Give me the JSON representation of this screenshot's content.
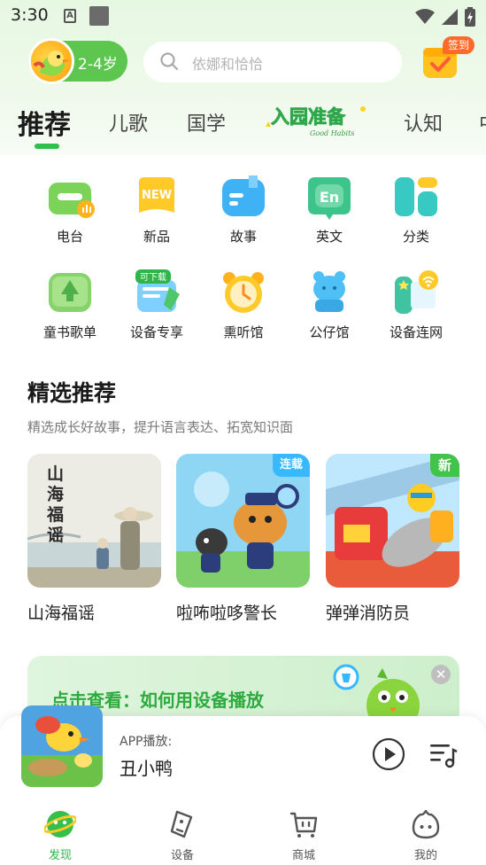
{
  "status_bar": {
    "time": "3:30",
    "a_icon": "A"
  },
  "header": {
    "age_label": "2-4岁",
    "search_placeholder": "依娜和恰恰",
    "checkin_label": "签到"
  },
  "tabs": [
    {
      "label": "推荐",
      "active": true
    },
    {
      "label": "儿歌"
    },
    {
      "label": "国学"
    },
    {
      "label": "入园准备",
      "sub": "Good Habits",
      "banner": true
    },
    {
      "label": "认知"
    },
    {
      "label": "中"
    }
  ],
  "grid": [
    {
      "label": "电台",
      "icon": "radio-icon"
    },
    {
      "label": "新品",
      "icon": "new-product-icon",
      "icon_text": "NEW"
    },
    {
      "label": "故事",
      "icon": "story-icon"
    },
    {
      "label": "英文",
      "icon": "english-icon",
      "icon_text": "En"
    },
    {
      "label": "分类",
      "icon": "category-icon"
    },
    {
      "label": "童书歌单",
      "icon": "book-playlist-icon"
    },
    {
      "label": "设备专享",
      "icon": "device-exclusive-icon",
      "icon_text": "可下载"
    },
    {
      "label": "熏听馆",
      "icon": "alarm-clock-icon"
    },
    {
      "label": "公仔馆",
      "icon": "doll-icon"
    },
    {
      "label": "设备连网",
      "icon": "device-wifi-icon"
    }
  ],
  "section": {
    "title": "精选推荐",
    "subtitle": "精选成长好故事，提升语言表达、拓宽知识面",
    "cards": [
      {
        "title": "山海福谣",
        "cover_text": "山海福谣",
        "tag": ""
      },
      {
        "title": "啦咘啦哆警长",
        "tag": "连载"
      },
      {
        "title": "弹弹消防员",
        "tag": "新"
      }
    ]
  },
  "promo": {
    "text": "点击查看：如何用设备播放"
  },
  "player": {
    "label": "APP播放:",
    "title": "丑小鸭"
  },
  "bottom_nav": [
    {
      "label": "发现",
      "icon": "discover-icon",
      "active": true
    },
    {
      "label": "设备",
      "icon": "device-icon"
    },
    {
      "label": "商城",
      "icon": "shop-cart-icon"
    },
    {
      "label": "我的",
      "icon": "profile-icon"
    }
  ],
  "colors": {
    "accent": "#2fbf4f",
    "age_pill": "#5cc64f",
    "checkin_badge": "#ff6a2b"
  }
}
